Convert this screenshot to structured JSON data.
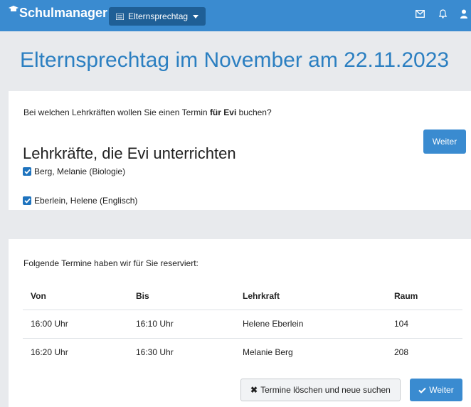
{
  "navbar": {
    "brand": "Schulmanager",
    "dropdown_label": "Elternsprechtag",
    "icons": [
      "list-icon",
      "mail-icon",
      "bell-icon",
      "user-icon"
    ]
  },
  "page": {
    "title": "Elternsprechtag im November am 22.11.2023"
  },
  "selection_card": {
    "intro_prefix": "Bei welchen Lehrkräften wollen Sie einen Termin ",
    "intro_bold": "für Evi",
    "intro_suffix": " buchen?",
    "section_title": "Lehrkräfte, die Evi unterrichten",
    "weiter_label": "Weiter",
    "teachers": [
      {
        "label": "Berg, Melanie (Biologie)",
        "checked": true
      },
      {
        "label": "Eberlein, Helene (Englisch)",
        "checked": true
      }
    ]
  },
  "reservation_card": {
    "intro": "Folgende Termine haben wir für Sie reserviert:",
    "columns": [
      "Von",
      "Bis",
      "Lehrkraft",
      "Raum"
    ],
    "rows": [
      [
        "16:00 Uhr",
        "16:10 Uhr",
        "Helene Eberlein",
        "104"
      ],
      [
        "16:20 Uhr",
        "16:30 Uhr",
        "Melanie Berg",
        "208"
      ]
    ],
    "delete_label": "Termine löschen und neue suchen",
    "weiter_label": "Weiter"
  },
  "colors": {
    "navbar": "#3a8bd0",
    "dropdown": "#1f5f96",
    "title": "#2b7fc1",
    "background": "#e8eaed",
    "checkbox": "#1e73be"
  }
}
